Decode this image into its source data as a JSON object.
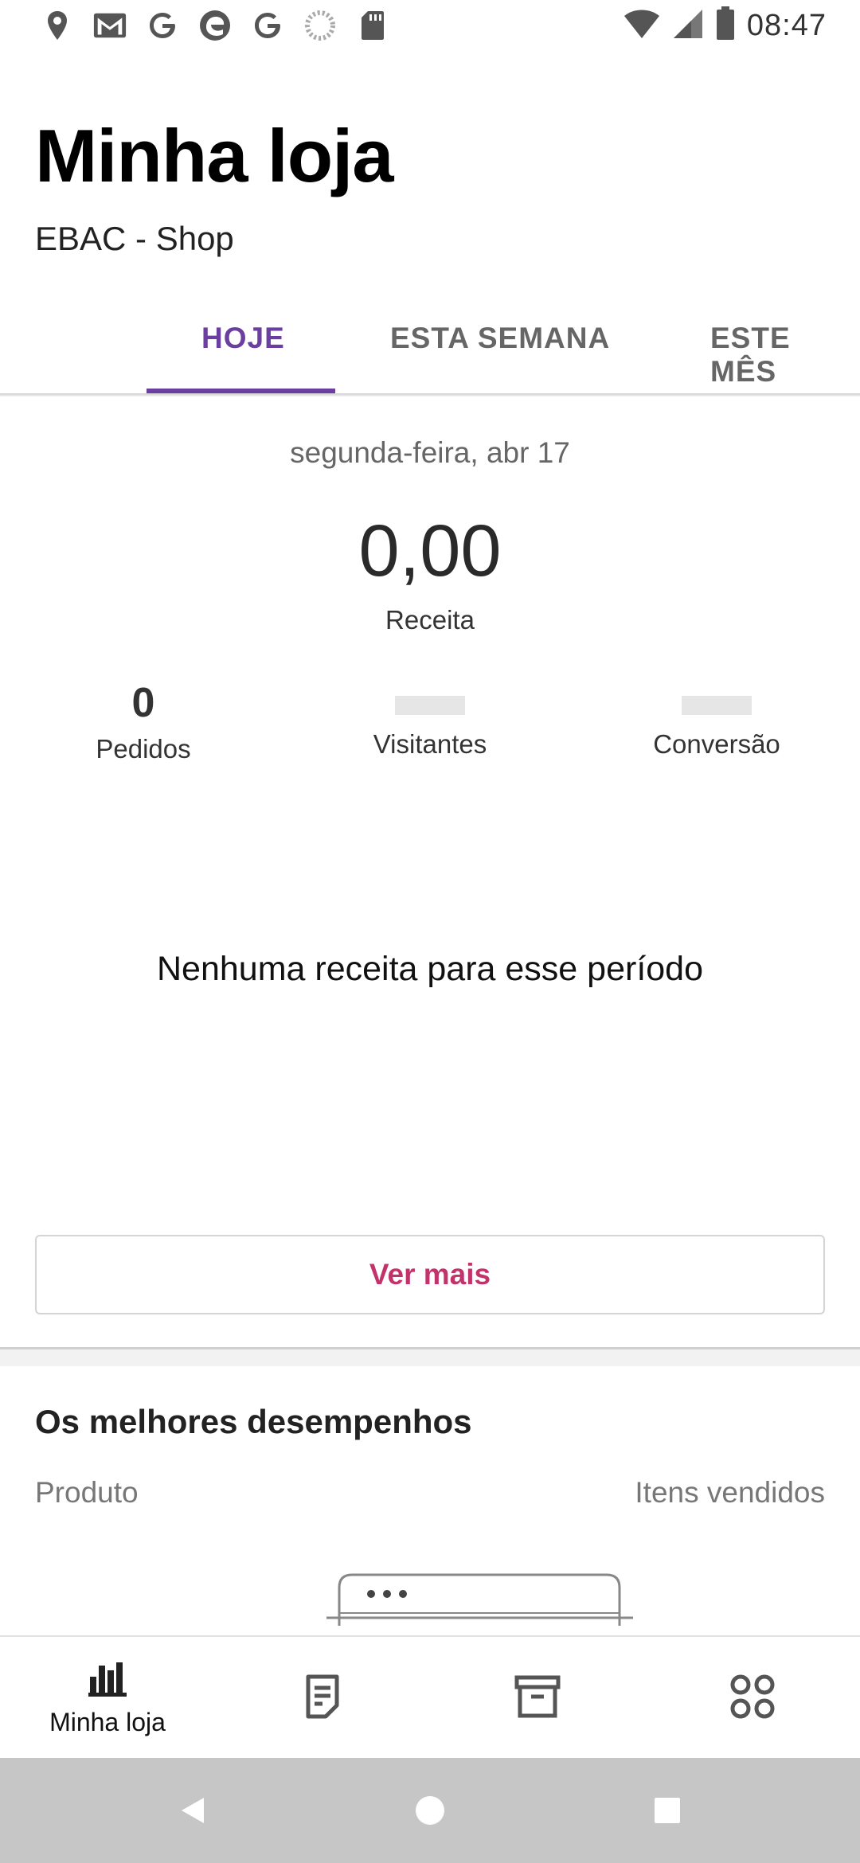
{
  "status_bar": {
    "time": "08:47",
    "notification_icons": [
      "location-icon",
      "gmail-icon",
      "google-icon",
      "edge-browser-icon",
      "google-icon",
      "loading-icon",
      "sd-card-icon"
    ],
    "system_icons": [
      "wifi-icon",
      "signal-icon",
      "battery-icon"
    ]
  },
  "header": {
    "title": "Minha loja",
    "store_name": "EBAC - Shop"
  },
  "tabs": [
    {
      "label": "HOJE",
      "active": true
    },
    {
      "label": "ESTA SEMANA",
      "active": false
    },
    {
      "label": "ESTE MÊS",
      "active": false
    }
  ],
  "stats": {
    "date": "segunda-feira, abr 17",
    "revenue_value": "0,00",
    "revenue_label": "Receita",
    "orders_value": "0",
    "orders_label": "Pedidos",
    "visitors_label": "Visitantes",
    "conversion_label": "Conversão"
  },
  "empty_state": {
    "message": "Nenhuma receita para esse período"
  },
  "more_button": {
    "label": "Ver mais"
  },
  "top_performers": {
    "title": "Os melhores desempenhos",
    "col_product": "Produto",
    "col_items_sold": "Itens vendidos"
  },
  "bottom_nav": {
    "items": [
      {
        "label": "Minha loja",
        "icon": "bar-chart-icon",
        "active": true
      },
      {
        "label": "",
        "icon": "orders-icon",
        "active": false
      },
      {
        "label": "",
        "icon": "archive-icon",
        "active": false
      },
      {
        "label": "",
        "icon": "grid-icon",
        "active": false
      }
    ]
  },
  "colors": {
    "accent": "#6b3fa0",
    "button_text": "#c2336b",
    "system_nav_bg": "#c6c6c6"
  }
}
